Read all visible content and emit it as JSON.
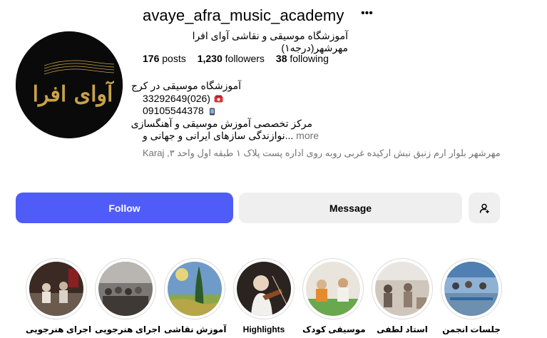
{
  "profile": {
    "username": "avaye_afra_music_academy",
    "full_name": "آموزشگاه موسیقی و نقاشی آوای افرا مهرشهر(درجه۱)",
    "logo_text": "آوای افرا"
  },
  "stats": {
    "posts_count": "176",
    "posts_label": "posts",
    "followers_count": "1,230",
    "followers_label": "followers",
    "following_count": "38",
    "following_label": "following"
  },
  "bio": {
    "line1": "آموزشگاه موسیقی در کرج",
    "line2": "33292649(026)",
    "line3": "09105544378",
    "line4": "مرکز تخصصی آموزش موسیقی و آهنگسازی",
    "line5": "نوازندگی سازهای ایرانی و جهانی و...",
    "more_label": "more",
    "address": "مهرشهر بلوار ارم زنبق نبش ارکیده غربی روبه روی اداره پست پلاک ۱ طبقه اول واحد ۳, Karaj"
  },
  "actions": {
    "follow_label": "Follow",
    "message_label": "Message"
  },
  "highlights": [
    {
      "label": "اجرای هنرجویی"
    },
    {
      "label": "اجرای هنرجویی"
    },
    {
      "label": "آموزش نقاشی"
    },
    {
      "label": "Highlights"
    },
    {
      "label": "موسیقی کودک"
    },
    {
      "label": "استاد لطفی"
    },
    {
      "label": "جلسات انجمن"
    }
  ],
  "colors": {
    "follow_button": "#4f5cf7",
    "secondary_button": "#efefef",
    "muted_text": "#737373",
    "logo_gold": "#c9a24a"
  }
}
